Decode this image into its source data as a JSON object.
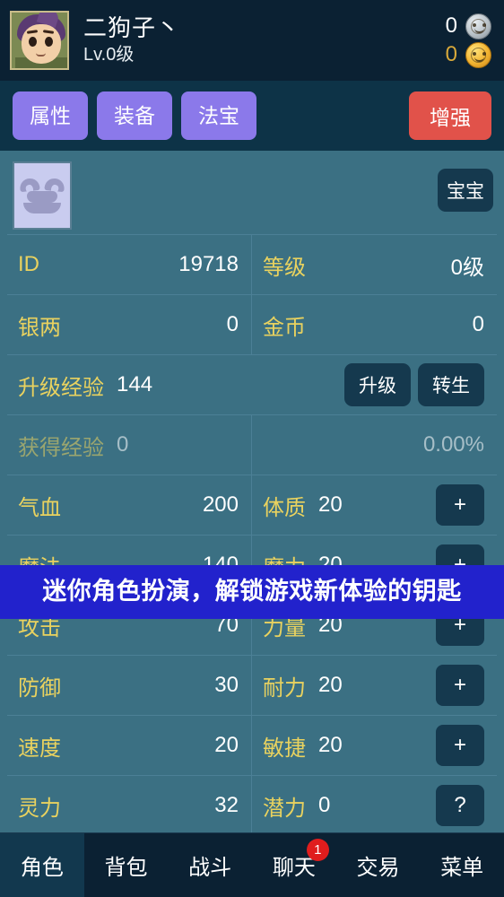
{
  "header": {
    "character_name": "二狗子丶",
    "level_text": "Lv.0级",
    "avatar_icon": "character-portrait-icon",
    "silver": {
      "value": "0",
      "icon": "silver-coin-icon"
    },
    "gold": {
      "value": "0",
      "icon": "gold-coin-icon"
    }
  },
  "tabs": {
    "items": [
      {
        "label": "属性",
        "name": "tab-attributes"
      },
      {
        "label": "装备",
        "name": "tab-equipment"
      },
      {
        "label": "法宝",
        "name": "tab-artifacts"
      }
    ],
    "boost_label": "增强"
  },
  "pet": {
    "slot_icon": "beast-face-icon",
    "baby_label": "宝宝"
  },
  "info_rows": [
    {
      "left_label": "ID",
      "left_value": "19718",
      "right_label": "等级",
      "right_value": "0级"
    },
    {
      "left_label": "银两",
      "left_value": "0",
      "right_label": "金币",
      "right_value": "0"
    }
  ],
  "exp_row": {
    "label": "升级经验",
    "value": "144",
    "levelup_label": "升级",
    "rebirth_label": "转生"
  },
  "gained_exp_row": {
    "left_label": "获得经验",
    "left_value": "0",
    "right_value": "0.00%"
  },
  "stats": [
    {
      "left_label": "气血",
      "left_value": "200",
      "right_label": "体质",
      "right_value": "20",
      "button": "+"
    },
    {
      "left_label": "魔法",
      "left_value": "140",
      "right_label": "魔力",
      "right_value": "20",
      "button": "+"
    },
    {
      "left_label": "攻击",
      "left_value": "70",
      "right_label": "力量",
      "right_value": "20",
      "button": "+"
    },
    {
      "left_label": "防御",
      "left_value": "30",
      "right_label": "耐力",
      "right_value": "20",
      "button": "+"
    },
    {
      "left_label": "速度",
      "left_value": "20",
      "right_label": "敏捷",
      "right_value": "20",
      "button": "+"
    },
    {
      "left_label": "灵力",
      "left_value": "32",
      "right_label": "潜力",
      "right_value": "0",
      "button": "?"
    }
  ],
  "banner": {
    "text": "迷你角色扮演，解锁游戏新体验的钥匙",
    "background": "#2222CC"
  },
  "bottom_nav": {
    "items": [
      {
        "label": "角色",
        "name": "nav-character",
        "active": true,
        "badge": ""
      },
      {
        "label": "背包",
        "name": "nav-bag",
        "active": false,
        "badge": ""
      },
      {
        "label": "战斗",
        "name": "nav-battle",
        "active": false,
        "badge": ""
      },
      {
        "label": "聊天",
        "name": "nav-chat",
        "active": false,
        "badge": "1"
      },
      {
        "label": "交易",
        "name": "nav-trade",
        "active": false,
        "badge": ""
      },
      {
        "label": "菜单",
        "name": "nav-menu",
        "active": false,
        "badge": ""
      }
    ]
  },
  "colors": {
    "panel": "#3B7083",
    "label": "#E9D25F",
    "value": "#FFFFFF",
    "tab": "#8B79EA",
    "boost": "#E1524A",
    "badge": "#E01D1D",
    "dark": "#0B2133"
  }
}
